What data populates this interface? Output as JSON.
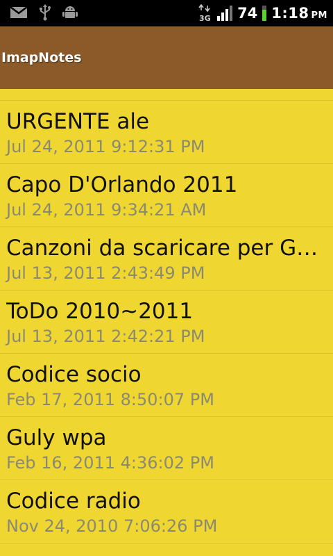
{
  "status_bar": {
    "icons_left": [
      "gmail-icon",
      "usb-icon",
      "android-debug-icon"
    ],
    "icons_right": [
      "3g-data-icon",
      "signal-bars-icon",
      "battery-icon"
    ],
    "battery": "74",
    "time": "1:18",
    "ampm": "PM"
  },
  "app": {
    "title": "ImapNotes"
  },
  "notes": [
    {
      "title": "URGENTE ale",
      "date": "Jul 24, 2011 9:12:31 PM"
    },
    {
      "title": "Capo D'Orlando 2011",
      "date": "Jul 24, 2011 9:34:21 AM"
    },
    {
      "title": "Canzoni da scaricare per Gul...",
      "date": "Jul 13, 2011 2:43:49 PM"
    },
    {
      "title": "ToDo 2010~2011",
      "date": "Jul 13, 2011 2:42:21 PM"
    },
    {
      "title": "Codice socio",
      "date": "Feb 17, 2011 8:50:07 PM"
    },
    {
      "title": "Guly wpa",
      "date": "Feb 16, 2011 4:36:02 PM"
    },
    {
      "title": "Codice radio",
      "date": "Nov 24, 2010 7:06:26 PM"
    }
  ],
  "colors": {
    "status_bar_bg": "#000000",
    "title_bar_bg": "#8b5a28",
    "list_bg": "#f0d630",
    "date_text": "#8a8a72"
  }
}
